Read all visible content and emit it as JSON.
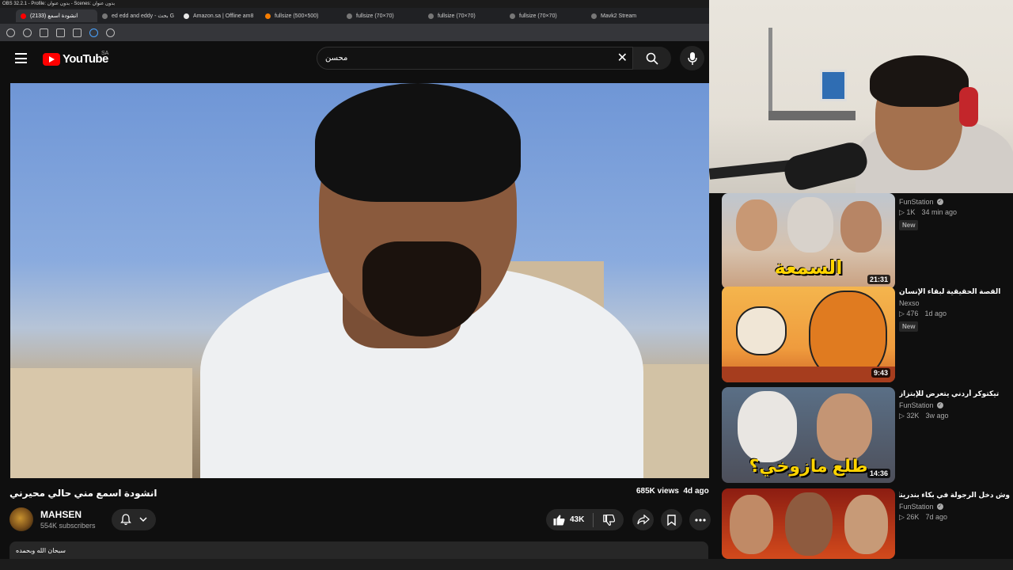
{
  "obs": {
    "title": "OBS 32.2.1 - Profile: بدون عنوان - Scenes: بدون عنوان"
  },
  "browser": {
    "tabs": [
      {
        "label": "(2133) انشودة اسمع",
        "active": true
      },
      {
        "label": "ed edd and eddy - بحث G"
      },
      {
        "label": "Amazon.sa | Offline am8"
      },
      {
        "label": "fullsize (500×500)"
      },
      {
        "label": "fullsize (70×70)"
      },
      {
        "label": "fullsize (70×70)"
      },
      {
        "label": "fullsize (70×70)"
      },
      {
        "label": "Mavk2 Stream"
      }
    ]
  },
  "header": {
    "logo_text": "YouTube",
    "country": "SA",
    "search_value": "محسن"
  },
  "video": {
    "title": "انشودة اسمع مني حالي محيرني",
    "views": "685K views",
    "age": "4d ago",
    "channel": "MAHSEN",
    "subscribers": "554K subscribers",
    "likes": "43K",
    "description": "سبحان الله وبحمده"
  },
  "recommendations": [
    {
      "title": "",
      "channel": "FunStation",
      "verified": true,
      "views": "1K",
      "age": "34 min ago",
      "badge": "New",
      "duration": "21:31",
      "overlay": "السمعة"
    },
    {
      "title": "القصة الحقيقية لبقاء الإنسان",
      "channel": "Nexso",
      "verified": false,
      "views": "476",
      "age": "1d ago",
      "badge": "New",
      "duration": "9:43",
      "overlay": ""
    },
    {
      "title": "تيكتوكر أردني يتعرض للإبتزاز",
      "channel": "FunStation",
      "verified": true,
      "views": "32K",
      "age": "3w ago",
      "badge": "",
      "duration": "14:36",
      "overlay": "طلع مازوخي؟"
    },
    {
      "title": "وش دخل الرجولة في بكاء بندريتا ؟",
      "channel": "FunStation",
      "verified": true,
      "views": "26K",
      "age": "7d ago",
      "badge": "",
      "duration": "",
      "overlay": ""
    }
  ],
  "colors": {
    "background": "#0f0f0f",
    "brand_red": "#ff0000",
    "button_bg": "#272727",
    "overlay_yellow": "#ffd400"
  }
}
